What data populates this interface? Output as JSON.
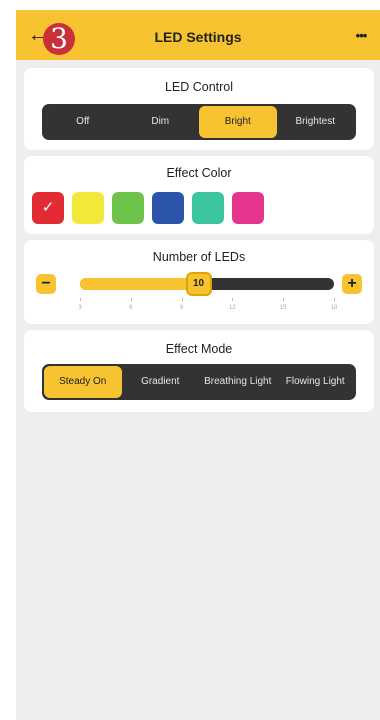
{
  "header": {
    "back_glyph": "←",
    "step_number": "3",
    "title": "LED Settings",
    "more_glyph": "•••"
  },
  "led_control": {
    "title": "LED Control",
    "options": [
      "Off",
      "Dim",
      "Bright",
      "Brightest"
    ],
    "selected": "Bright"
  },
  "effect_color": {
    "title": "Effect Color",
    "swatches": [
      "#e22b33",
      "#f2e83a",
      "#6fc24b",
      "#2a55a8",
      "#3cc4a0",
      "#e6358f"
    ],
    "selected_index": 0,
    "check_glyph": "✓"
  },
  "num_leds": {
    "title": "Number of LEDs",
    "value": "10",
    "min": 3,
    "max": 18,
    "minus_label": "−",
    "plus_label": "+",
    "ticks": [
      "3",
      "6",
      "9",
      "12",
      "15",
      "18"
    ]
  },
  "effect_mode": {
    "title": "Effect Mode",
    "options": [
      "Steady On",
      "Gradient",
      "Breathing Light",
      "Flowing Light"
    ],
    "selected": "Steady On"
  },
  "colors": {
    "accent": "#f8c331",
    "dark": "#333333",
    "background": "#eeeeee",
    "badge": "#c9303a"
  }
}
